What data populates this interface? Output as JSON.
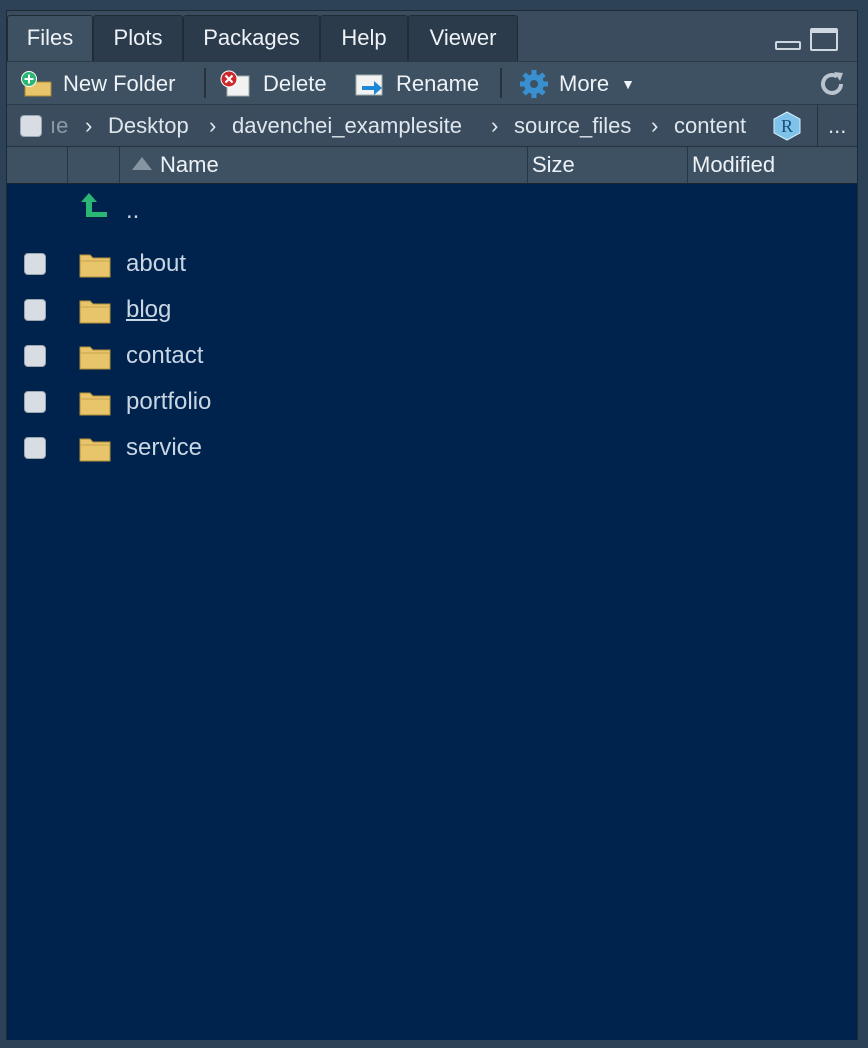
{
  "tabs": [
    {
      "label": "Files",
      "active": true
    },
    {
      "label": "Plots",
      "active": false
    },
    {
      "label": "Packages",
      "active": false
    },
    {
      "label": "Help",
      "active": false
    },
    {
      "label": "Viewer",
      "active": false
    }
  ],
  "toolbar": {
    "new_folder": "New Folder",
    "delete": "Delete",
    "rename": "Rename",
    "more": "More"
  },
  "breadcrumb": {
    "truncated": "ıe",
    "items": [
      "Desktop",
      "davenchei_examplesite",
      "source_files",
      "content"
    ],
    "project_icon_letter": "R",
    "overflow": "..."
  },
  "columns": {
    "name": "Name",
    "size": "Size",
    "modified": "Modified"
  },
  "files": {
    "parent": "..",
    "items": [
      {
        "name": "about",
        "type": "folder"
      },
      {
        "name": "blog",
        "type": "folder",
        "hovered": true
      },
      {
        "name": "contact",
        "type": "folder"
      },
      {
        "name": "portfolio",
        "type": "folder"
      },
      {
        "name": "service",
        "type": "folder"
      }
    ]
  },
  "colors": {
    "list_bg": "#00234d",
    "folder": "#e8c56a",
    "up_arrow": "#2bb673",
    "text": "#c9d6e4"
  }
}
